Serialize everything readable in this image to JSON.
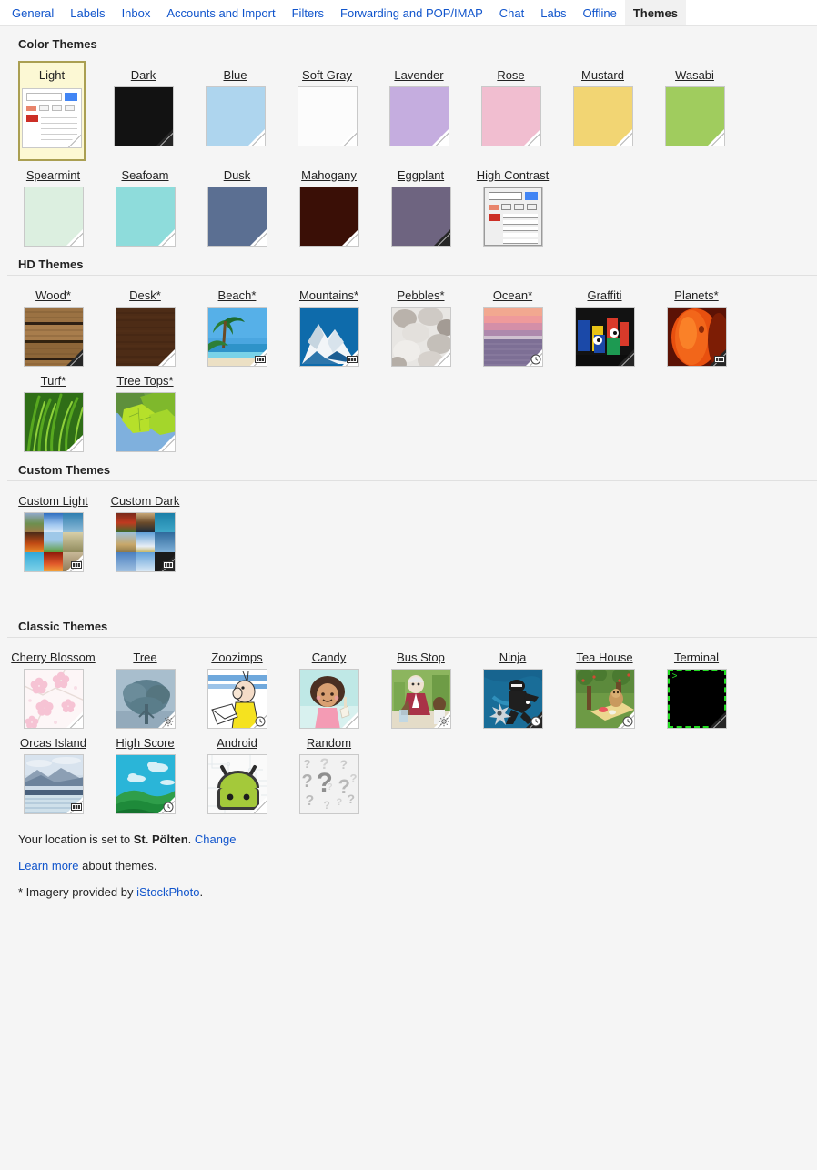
{
  "tabs": [
    {
      "label": "General",
      "active": false
    },
    {
      "label": "Labels",
      "active": false
    },
    {
      "label": "Inbox",
      "active": false
    },
    {
      "label": "Accounts and Import",
      "active": false
    },
    {
      "label": "Filters",
      "active": false
    },
    {
      "label": "Forwarding and POP/IMAP",
      "active": false
    },
    {
      "label": "Chat",
      "active": false
    },
    {
      "label": "Labs",
      "active": false
    },
    {
      "label": "Offline",
      "active": false
    },
    {
      "label": "Themes",
      "active": true
    }
  ],
  "sections": [
    {
      "title": "Color Themes",
      "themes": [
        {
          "name": "Light",
          "selected": true,
          "kind": "mini-ui"
        },
        {
          "name": "Dark",
          "kind": "solid",
          "color": "#121212",
          "fold": "dark"
        },
        {
          "name": "Blue",
          "kind": "solid",
          "color": "#aed5ee"
        },
        {
          "name": "Soft Gray",
          "kind": "solid",
          "color": "#fcfcfc"
        },
        {
          "name": "Lavender",
          "kind": "solid",
          "color": "#c5addf"
        },
        {
          "name": "Rose",
          "kind": "solid",
          "color": "#f1bed0"
        },
        {
          "name": "Mustard",
          "kind": "solid",
          "color": "#f2d573"
        },
        {
          "name": "Wasabi",
          "kind": "solid",
          "color": "#a0cc5e"
        },
        {
          "name": "Spearmint",
          "kind": "solid",
          "color": "#dcefe0"
        },
        {
          "name": "Seafoam",
          "kind": "solid",
          "color": "#8edcdb"
        },
        {
          "name": "Dusk",
          "kind": "solid",
          "color": "#5b6f92"
        },
        {
          "name": "Mahogany",
          "kind": "solid",
          "color": "#3a0f06"
        },
        {
          "name": "Eggplant",
          "kind": "solid",
          "color": "#6e6480",
          "fold": "dark"
        },
        {
          "name": "High Contrast",
          "kind": "mini-ui-hc"
        }
      ]
    },
    {
      "title": "HD Themes",
      "themes": [
        {
          "name": "Wood*",
          "kind": "photo",
          "art": "wood",
          "fold": "dark"
        },
        {
          "name": "Desk*",
          "kind": "photo",
          "art": "desk"
        },
        {
          "name": "Beach*",
          "kind": "photo",
          "art": "beach",
          "badge": "panorama-icon"
        },
        {
          "name": "Mountains*",
          "kind": "photo",
          "art": "mountains",
          "badge": "panorama-icon"
        },
        {
          "name": "Pebbles*",
          "kind": "photo",
          "art": "pebbles"
        },
        {
          "name": "Ocean*",
          "kind": "photo",
          "art": "ocean",
          "badge": "clock-icon"
        },
        {
          "name": "Graffiti",
          "kind": "photo",
          "art": "graffiti",
          "fold": "dark"
        },
        {
          "name": "Planets*",
          "kind": "photo",
          "art": "planets",
          "fold": "dark",
          "badge": "panorama-icon"
        },
        {
          "name": "Turf*",
          "kind": "photo",
          "art": "turf"
        },
        {
          "name": "Tree Tops*",
          "kind": "photo",
          "art": "treetops"
        }
      ]
    },
    {
      "title": "Custom Themes",
      "themes": [
        {
          "name": "Custom Light",
          "kind": "mosaic",
          "art": "mosaic-light",
          "badge": "panorama-icon"
        },
        {
          "name": "Custom Dark",
          "kind": "mosaic",
          "art": "mosaic-dark",
          "fold": "dark",
          "badge": "panorama-icon"
        }
      ]
    },
    {
      "title": "Classic Themes",
      "themes": [
        {
          "name": "Cherry Blossom",
          "kind": "photo",
          "art": "cherry"
        },
        {
          "name": "Tree",
          "kind": "photo",
          "art": "tree",
          "badge": "weather-icon"
        },
        {
          "name": "Zoozimps",
          "kind": "photo",
          "art": "zoozimps",
          "badge": "clock-icon"
        },
        {
          "name": "Candy",
          "kind": "photo",
          "art": "candy"
        },
        {
          "name": "Bus Stop",
          "kind": "photo",
          "art": "busstop",
          "badge": "weather-icon"
        },
        {
          "name": "Ninja",
          "kind": "photo",
          "art": "ninja",
          "fold": "dark",
          "badge": "clock-icon"
        },
        {
          "name": "Tea House",
          "kind": "photo",
          "art": "teahouse",
          "badge": "clock-icon"
        },
        {
          "name": "Terminal",
          "kind": "terminal",
          "prompt": ">",
          "fold": "dark"
        },
        {
          "name": "Orcas Island",
          "kind": "photo",
          "art": "orcas",
          "badge": "panorama-icon"
        },
        {
          "name": "High Score",
          "kind": "photo",
          "art": "highscore",
          "badge": "clock-icon"
        },
        {
          "name": "Android",
          "kind": "photo",
          "art": "android"
        },
        {
          "name": "Random",
          "kind": "random"
        }
      ]
    }
  ],
  "footer": {
    "location_prefix": "Your location is set to ",
    "location_name": "St. Pölten",
    "location_suffix": ". ",
    "change_link": "Change",
    "learn_more_link": "Learn more",
    "learn_more_rest": " about themes.",
    "imagery_prefix": "* Imagery provided by ",
    "imagery_link": "iStockPhoto",
    "imagery_suffix": "."
  }
}
